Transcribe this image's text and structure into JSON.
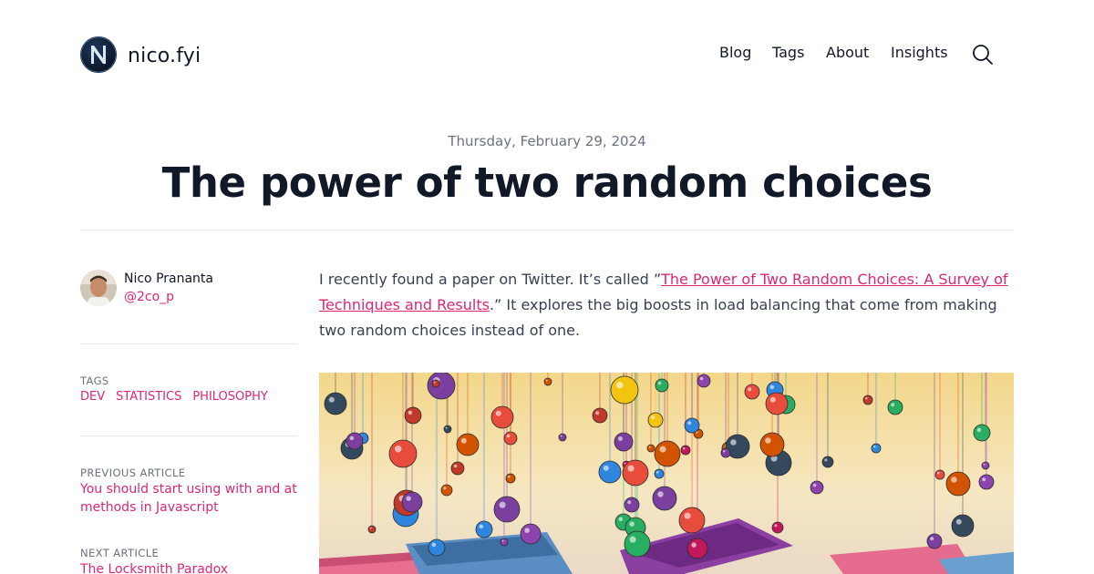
{
  "site": {
    "name": "nico.fyi",
    "nav": [
      {
        "label": "Blog"
      },
      {
        "label": "Tags"
      },
      {
        "label": "About"
      },
      {
        "label": "Insights"
      }
    ],
    "search_icon": "search-icon"
  },
  "article": {
    "date": "Thursday, February 29, 2024",
    "title": "The power of two random choices",
    "intro_before": "I recently found a paper on Twitter. It’s called ”",
    "intro_link": "The Power of Two Random Choices: A Survey of Techniques and Results",
    "intro_after": ".” It explores the big boosts in load balancing that come from making two random choices instead of one."
  },
  "author": {
    "name": "Nico Prananta",
    "handle": "@2co_p"
  },
  "sidebar": {
    "tags_label": "TAGS",
    "tags": [
      "DEV",
      "STATISTICS",
      "PHILOSOPHY"
    ],
    "previous_label": "PREVIOUS ARTICLE",
    "previous_title": "You should start using with and at methods in Javascript",
    "next_label": "NEXT ARTICLE",
    "next_title": "The Locksmith Paradox"
  },
  "colors": {
    "accent": "#db2777",
    "text": "#111827",
    "muted": "#6b7280"
  }
}
